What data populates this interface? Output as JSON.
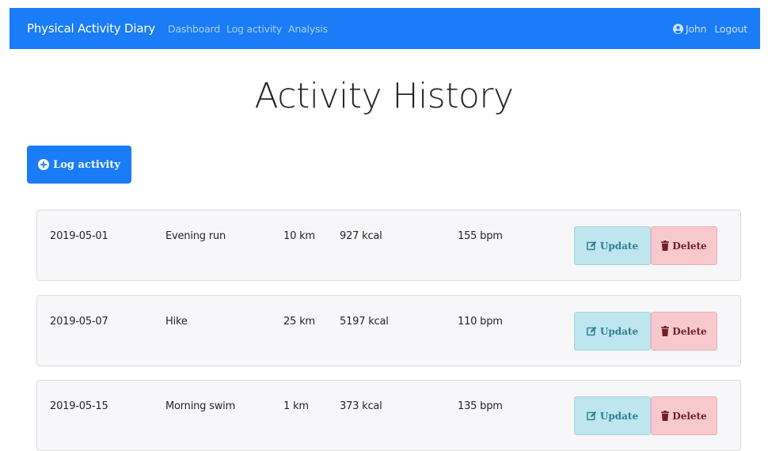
{
  "navbar": {
    "brand": "Physical Activity Diary",
    "links": [
      "Dashboard",
      "Log activity",
      "Analysis"
    ],
    "user": "John",
    "logout": "Logout",
    "color": "#1a7cf7"
  },
  "page": {
    "title": "Activity History",
    "log_button": "Log activity"
  },
  "activities": [
    {
      "date": "2019-05-01",
      "name": "Evening run",
      "distance": "10 km",
      "calories": "927 kcal",
      "heart_rate": "155 bpm",
      "update_label": "Update",
      "delete_label": "Delete"
    },
    {
      "date": "2019-05-07",
      "name": "Hike",
      "distance": "25 km",
      "calories": "5197 kcal",
      "heart_rate": "110 bpm",
      "update_label": "Update",
      "delete_label": "Delete"
    },
    {
      "date": "2019-05-15",
      "name": "Morning swim",
      "distance": "1 km",
      "calories": "373 kcal",
      "heart_rate": "135 bpm",
      "update_label": "Update",
      "delete_label": "Delete"
    }
  ],
  "icons": {
    "user": "user-circle-icon",
    "log": "plus-circle-icon",
    "update": "edit-icon",
    "delete": "trash-icon"
  }
}
